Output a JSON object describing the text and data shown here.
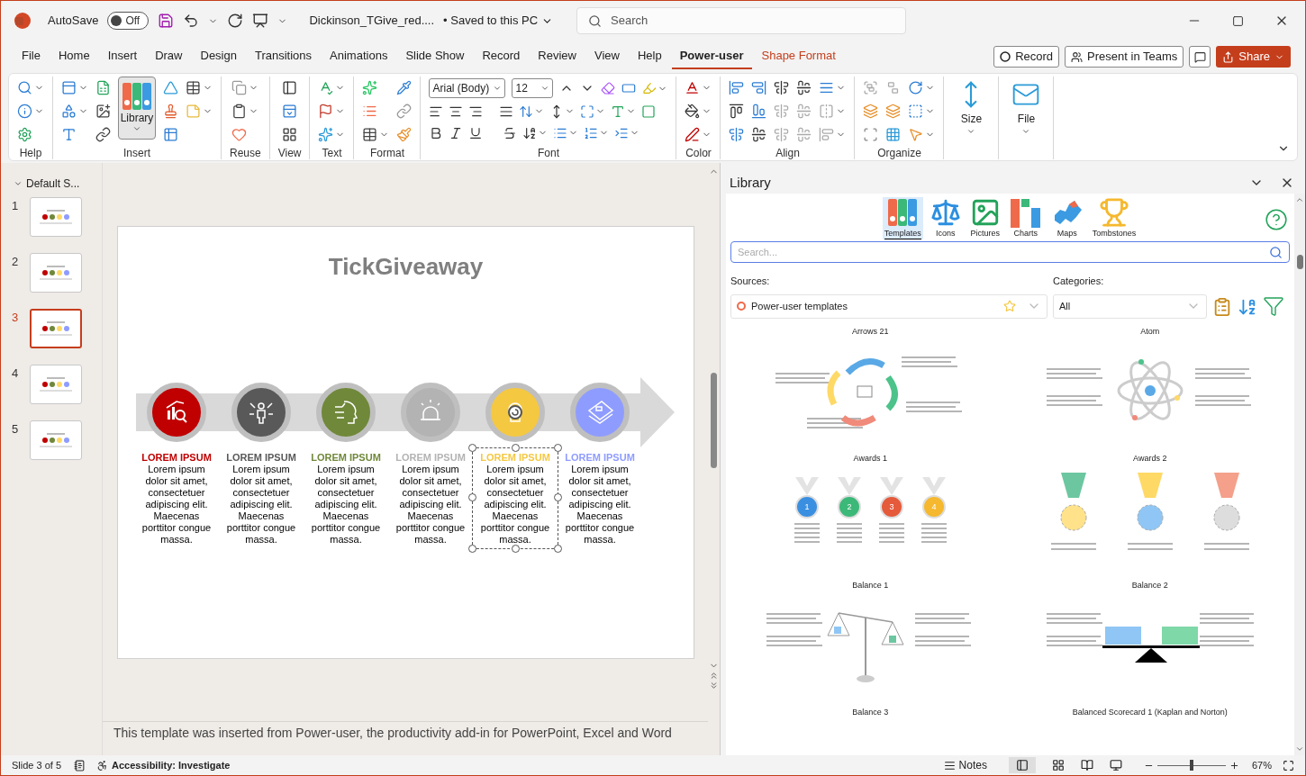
{
  "title_bar": {
    "autosave_label": "AutoSave",
    "autosave_state": "Off",
    "autosave_on": false,
    "document": "Dickinson_TGive_red....",
    "save_status": "• Saved to this PC",
    "search_placeholder": "Search"
  },
  "menu_tabs": [
    {
      "label": "File",
      "selected": false,
      "kind": "normal"
    },
    {
      "label": "Home",
      "selected": false,
      "kind": "normal"
    },
    {
      "label": "Insert",
      "selected": false,
      "kind": "normal"
    },
    {
      "label": "Draw",
      "selected": false,
      "kind": "normal"
    },
    {
      "label": "Design",
      "selected": false,
      "kind": "normal"
    },
    {
      "label": "Transitions",
      "selected": false,
      "kind": "normal"
    },
    {
      "label": "Animations",
      "selected": false,
      "kind": "normal"
    },
    {
      "label": "Slide Show",
      "selected": false,
      "kind": "normal"
    },
    {
      "label": "Record",
      "selected": false,
      "kind": "normal"
    },
    {
      "label": "Review",
      "selected": false,
      "kind": "normal"
    },
    {
      "label": "View",
      "selected": false,
      "kind": "normal"
    },
    {
      "label": "Help",
      "selected": false,
      "kind": "normal"
    },
    {
      "label": "Power-user",
      "selected": true,
      "kind": "normal"
    },
    {
      "label": "Shape Format",
      "selected": false,
      "kind": "contextual"
    }
  ],
  "header_buttons": {
    "record": "Record",
    "teams": "Present in Teams",
    "share": "Share"
  },
  "ribbon_groups": [
    {
      "kind": "help",
      "label": "Help"
    },
    {
      "kind": "insert",
      "label": "Insert",
      "button": "Library"
    },
    {
      "kind": "reuse",
      "label": "Reuse"
    },
    {
      "kind": "view",
      "label": "View"
    },
    {
      "kind": "text",
      "label": "Text"
    },
    {
      "kind": "format",
      "label": "Format"
    },
    {
      "kind": "font",
      "label": "Font",
      "font": "Arial (Body)",
      "size": "12"
    },
    {
      "kind": "color",
      "label": "Color"
    },
    {
      "kind": "align",
      "label": "Align"
    },
    {
      "kind": "organize",
      "label": "Organize"
    },
    {
      "kind": "size",
      "button": "Size"
    },
    {
      "kind": "file",
      "button": "File"
    }
  ],
  "slides_pane": {
    "section": "Default S...",
    "slides": [
      {
        "number": "1",
        "selected": false
      },
      {
        "number": "2",
        "selected": false
      },
      {
        "number": "3",
        "selected": true
      },
      {
        "number": "4",
        "selected": false
      },
      {
        "number": "5",
        "selected": false
      }
    ]
  },
  "slide": {
    "title": "TickGiveaway",
    "steps": [
      {
        "heading": "LOREM IPSUM",
        "body": "Lorem ipsum dolor sit amet, consectetuer adipiscing elit. Maecenas porttitor congue massa.",
        "color": "#c00000",
        "selected": false
      },
      {
        "heading": "LOREM IPSUM",
        "body": "Lorem ipsum dolor sit amet, consectetuer adipiscing elit. Maecenas porttitor congue massa.",
        "color": "#595959",
        "selected": false
      },
      {
        "heading": "LOREM IPSUM",
        "body": "Lorem ipsum dolor sit amet, consectetuer adipiscing elit. Maecenas porttitor congue massa.",
        "color": "#70883a",
        "selected": false
      },
      {
        "heading": "LOREM IPSUM",
        "body": "Lorem ipsum dolor sit amet, consectetuer adipiscing elit. Maecenas porttitor congue massa.",
        "color": "#b3b3b3",
        "selected": false
      },
      {
        "heading": "LOREM IPSUM",
        "body": "Lorem ipsum dolor sit amet, consectetuer adipiscing elit. Maecenas porttitor congue massa.",
        "color": "#f5c842",
        "selected": true
      },
      {
        "heading": "LOREM IPSUM",
        "body": "Lorem ipsum dolor sit amet, consectetuer adipiscing elit. Maecenas porttitor congue massa.",
        "color": "#8f9cff",
        "selected": false
      }
    ]
  },
  "notes": "This template was inserted from Power-user, the productivity add-in for PowerPoint, Excel and Word",
  "library": {
    "title": "Library",
    "categories": [
      {
        "label": "Templates",
        "kind": "templates",
        "selected": true
      },
      {
        "label": "Icons",
        "kind": "icons",
        "selected": false
      },
      {
        "label": "Pictures",
        "kind": "pictures",
        "selected": false
      },
      {
        "label": "Charts",
        "kind": "charts",
        "selected": false
      },
      {
        "label": "Maps",
        "kind": "maps",
        "selected": false
      },
      {
        "label": "Tombstones",
        "kind": "tombstones",
        "selected": false
      }
    ],
    "search_placeholder": "Search...",
    "sources_label": "Sources:",
    "source": "Power-user templates",
    "categories_label": "Categories:",
    "category": "All",
    "templates": [
      {
        "name": "Arrows 21",
        "kind": "arrows"
      },
      {
        "name": "Atom",
        "kind": "atom"
      },
      {
        "name": "Awards 1",
        "kind": "awards1",
        "labels": [
          "1",
          "2",
          "3",
          "4"
        ]
      },
      {
        "name": "Awards 2",
        "kind": "awards2"
      },
      {
        "name": "Balance 1",
        "kind": "balance1"
      },
      {
        "name": "Balance 2",
        "kind": "balance2"
      },
      {
        "name": "Balance 3",
        "kind": "cut"
      },
      {
        "name": "Balanced Scorecard 1 (Kaplan and Norton)",
        "kind": "cut"
      }
    ]
  },
  "status_bar": {
    "slide_info": "Slide 3 of 5",
    "accessibility": "Accessibility: Investigate",
    "notes": "Notes",
    "zoom": "67%",
    "zoom_slider": {
      "level": 0.5
    }
  }
}
